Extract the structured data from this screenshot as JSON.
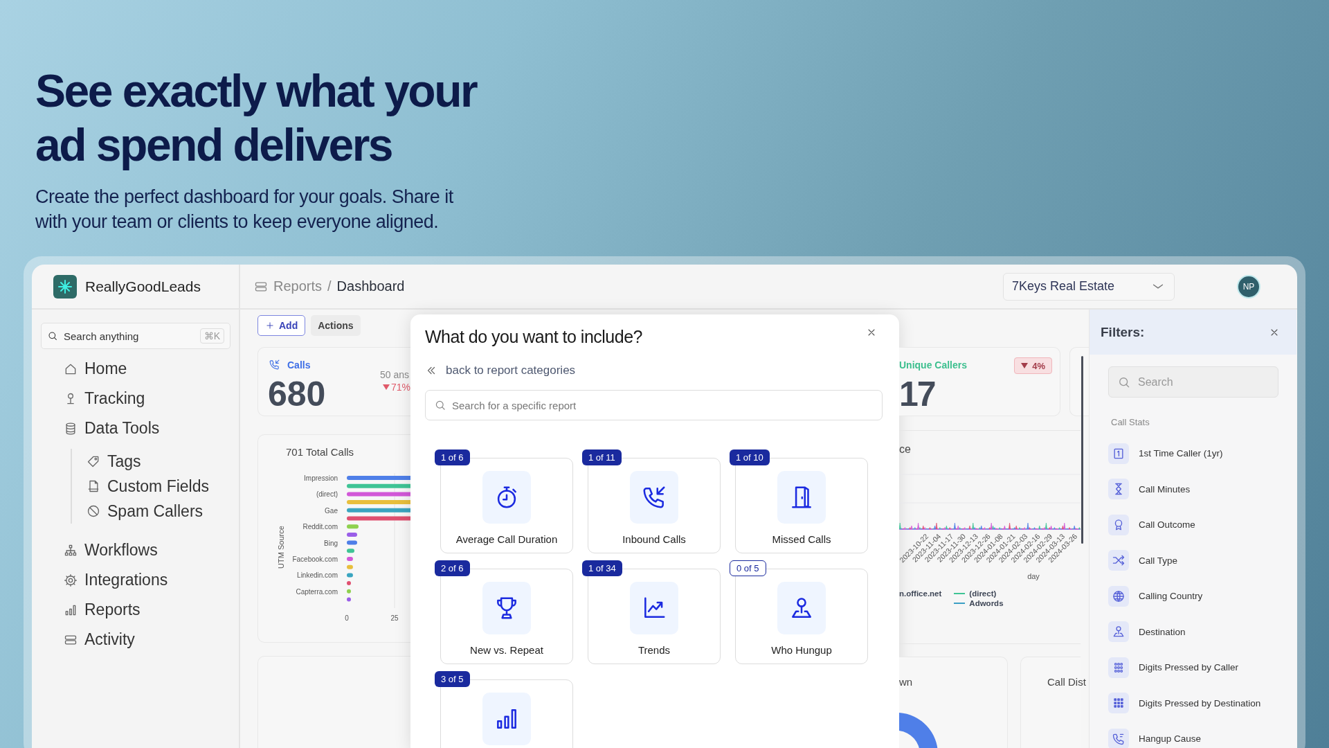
{
  "hero": {
    "headline": [
      "See exactly what your",
      "ad spend delivers"
    ],
    "subtitle": [
      "Create the perfect dashboard for your goals. Share it",
      "with your team or clients to keep everyone aligned."
    ]
  },
  "brand": "ReallyGoodLeads",
  "breadcrumb": {
    "parent": "Reports",
    "separator": "/",
    "current": "Dashboard"
  },
  "account_select": {
    "value": "7Keys Real Estate"
  },
  "avatar": "NP",
  "sidebar": {
    "search": {
      "placeholder": "Search anything",
      "shortcut": "⌘K"
    },
    "items": [
      {
        "label": "Home"
      },
      {
        "label": "Tracking"
      },
      {
        "label": "Data Tools",
        "children": [
          {
            "label": "Tags"
          },
          {
            "label": "Custom Fields"
          },
          {
            "label": "Spam Callers"
          }
        ]
      },
      {
        "label": "Workflows"
      },
      {
        "label": "Integrations"
      },
      {
        "label": "Reports"
      },
      {
        "label": "Activity"
      }
    ]
  },
  "toolbar": {
    "add": "Add",
    "actions": "Actions"
  },
  "calls_card": {
    "label": "Calls",
    "value": "680",
    "detail": "50 ans",
    "change": "71%"
  },
  "sources_chart": {
    "title": "701 Total Calls",
    "axis_title": "UTM Source",
    "labels": [
      "Impression",
      "(direct)",
      "Gae",
      "Reddit.com",
      "Bing",
      "Facebook.com",
      "Linkedin.com",
      "Capterra.com"
    ],
    "ticks": [
      "0",
      "25"
    ]
  },
  "unique_callers_card": {
    "label": "Unique Callers",
    "value": "17",
    "change": "4%"
  },
  "trend_chart": {
    "title": "ce",
    "dates": [
      "2023-10-22",
      "2023-11-04",
      "2023-11-17",
      "2023-11-30",
      "2023-12-13",
      "2023-12-26",
      "2024-01-08",
      "2024-01-21",
      "2024-02-03",
      "2024-02-16",
      "2024-02-29",
      "2024-03-13",
      "2024-03-26"
    ],
    "axis_title": "day",
    "legend": [
      {
        "label": "n.office.net"
      },
      {
        "label": "(direct)",
        "color": "#3fc495"
      },
      {
        "label": "Adwords",
        "color": "#3b9fc4"
      }
    ]
  },
  "bottom_cards": [
    {
      "title": "wn"
    },
    {
      "title": "Call Dist"
    }
  ],
  "modal": {
    "title": "What do you want to include?",
    "back_link": "back to report categories",
    "search_placeholder": "Search for a specific report",
    "reports": [
      {
        "label": "Average Call Duration",
        "count": "1 of 6",
        "selected": true
      },
      {
        "label": "Inbound Calls",
        "count": "1 of 11",
        "selected": true
      },
      {
        "label": "Missed Calls",
        "count": "1 of 10",
        "selected": true
      },
      {
        "label": "New vs. Repeat",
        "count": "2 of 6",
        "selected": true
      },
      {
        "label": "Trends",
        "count": "1 of 34",
        "selected": true
      },
      {
        "label": "Who Hungup",
        "count": "0 of 5",
        "selected": false
      },
      {
        "count": "3 of 5",
        "selected": true
      }
    ]
  },
  "filters": {
    "title": "Filters:",
    "search_placeholder": "Search",
    "group": "Call Stats",
    "items": [
      "1st Time Caller (1yr)",
      "Call Minutes",
      "Call Outcome",
      "Call Type",
      "Calling Country",
      "Destination",
      "Digits Pressed by Caller",
      "Digits Pressed by Destination",
      "Hangup Cause"
    ]
  }
}
